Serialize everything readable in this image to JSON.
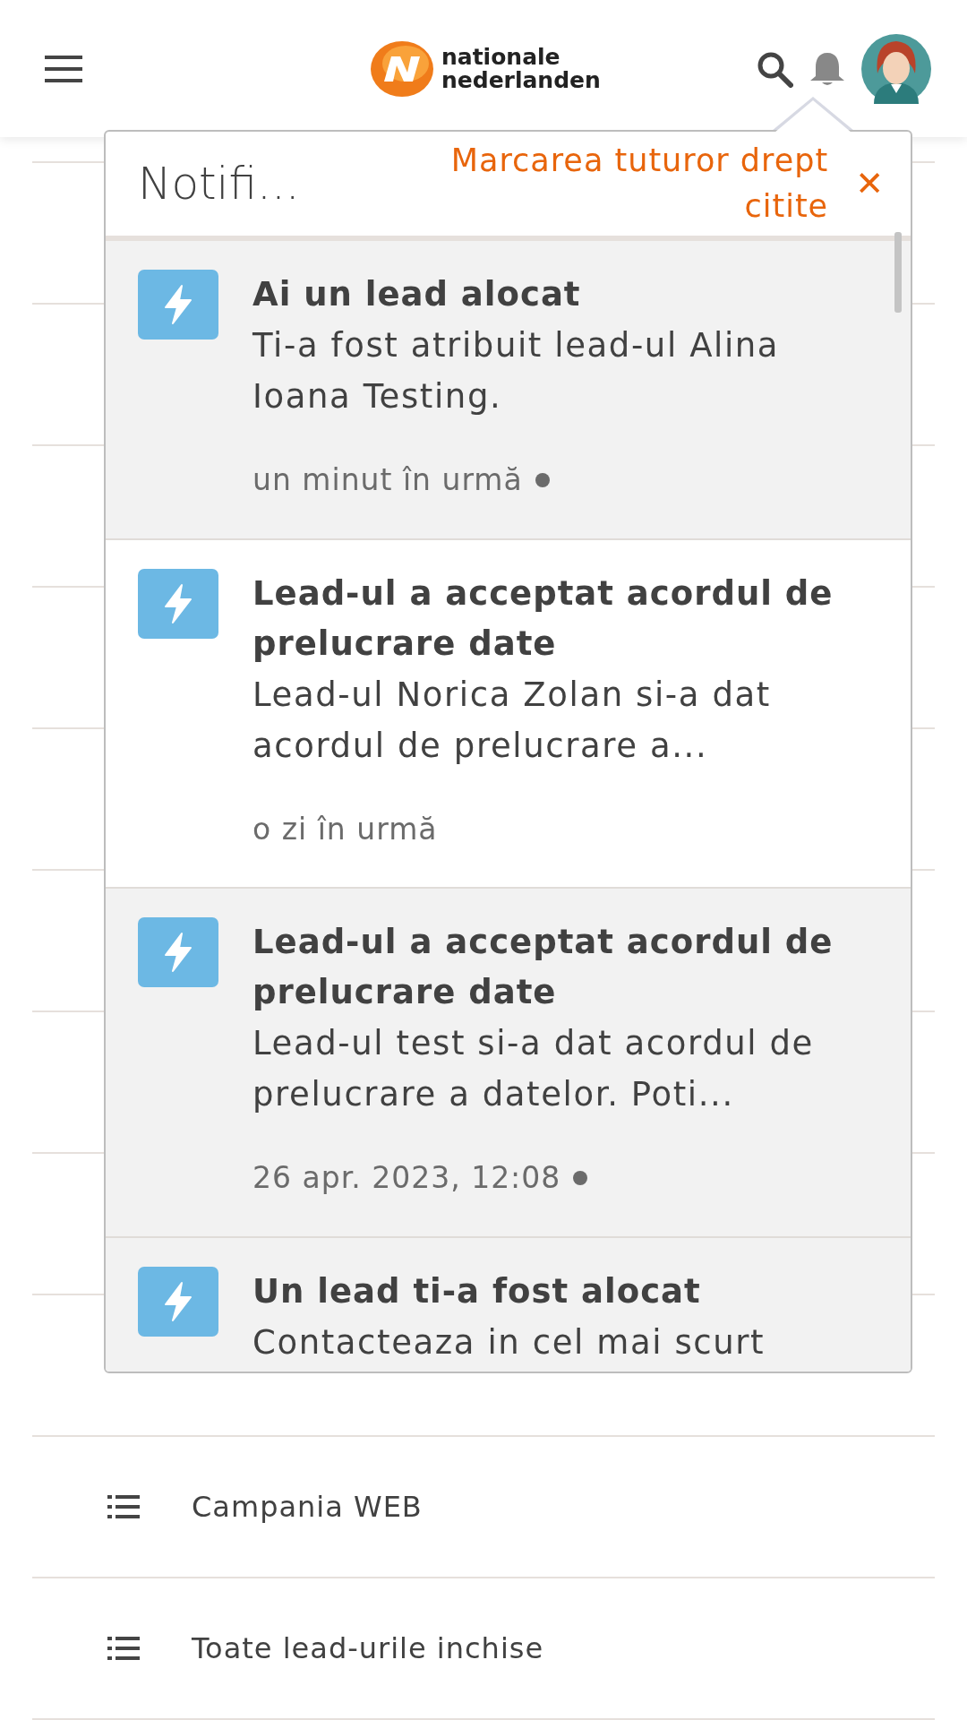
{
  "header": {
    "logo_line1": "nationale",
    "logo_line2": "nederlanden"
  },
  "list": [
    {
      "label": "Campania WEB"
    },
    {
      "label": "Toate lead-urile inchise"
    }
  ],
  "notifications": {
    "title": "Notifi...",
    "mark_all": "Marcarea tuturor drept citite",
    "close": "✕",
    "items": [
      {
        "title": "Ai un lead alocat",
        "body": "Ti-a fost atribuit lead-ul Alina Ioana Testing.",
        "time": "un minut în urmă",
        "unread": true
      },
      {
        "title": "Lead-ul a acceptat acordul de prelucrare date",
        "body": "Lead-ul Norica Zolan si-a dat acordul de prelucrare a...",
        "time": "o zi în urmă",
        "unread": false
      },
      {
        "title": "Lead-ul a acceptat acordul de prelucrare date",
        "body": "Lead-ul test si-a dat acordul de prelucrare a datelor. Poti...",
        "time": "26 apr. 2023, 12:08",
        "unread": true
      },
      {
        "title": "Un lead ti-a fost alocat",
        "body": "Contacteaza in cel mai scurt",
        "unread": true
      }
    ]
  }
}
